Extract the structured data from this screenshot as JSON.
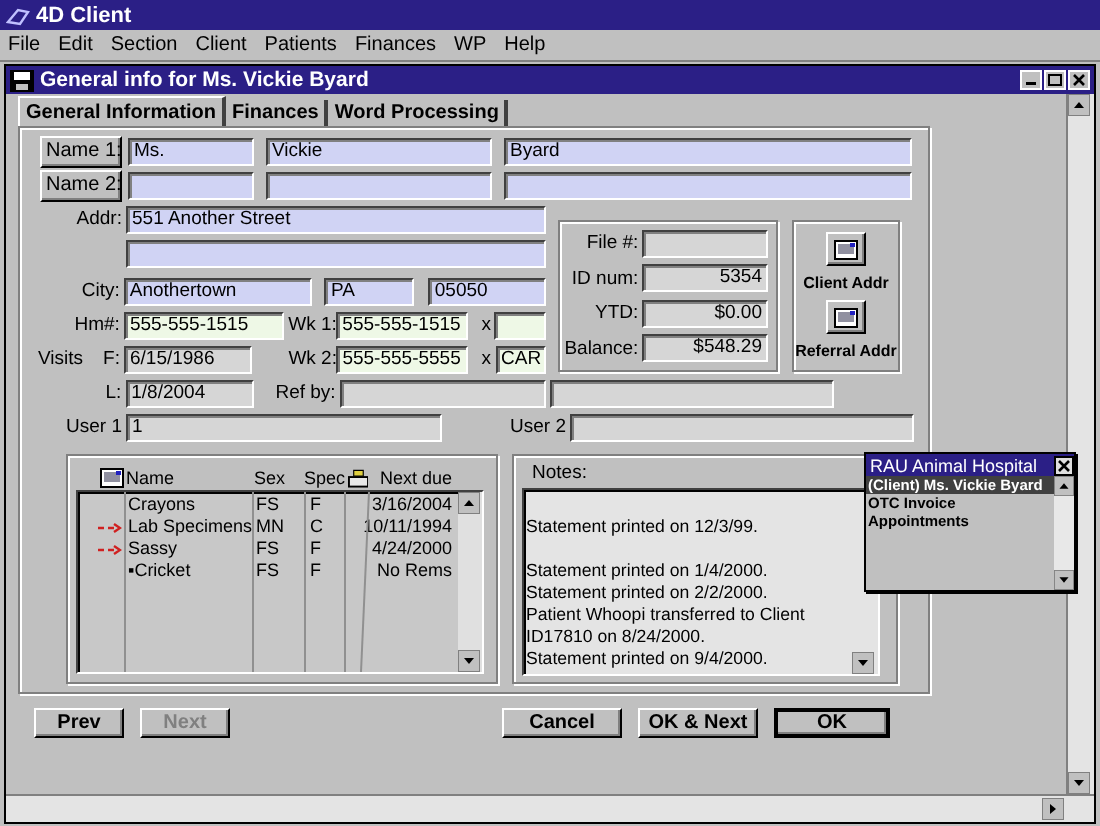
{
  "app_title": "4D Client",
  "menu": [
    "File",
    "Edit",
    "Section",
    "Client",
    "Patients",
    "Finances",
    "WP",
    "Help"
  ],
  "window_title": "General info for Ms. Vickie Byard",
  "tabs": [
    {
      "label": "General Information",
      "selected": true
    },
    {
      "label": "Finances",
      "selected": false
    },
    {
      "label": "Word Processing",
      "selected": false
    }
  ],
  "name_rows": [
    {
      "button": "Name 1:",
      "fields": [
        "Ms.",
        "Vickie",
        "Byard"
      ]
    },
    {
      "button": "Name 2:"
    }
  ],
  "address": {
    "label": "Addr:",
    "line1": "551 Another Street"
  },
  "city": {
    "label": "City:",
    "city": "Anothertown",
    "state": "PA",
    "zip": "05050"
  },
  "home_phone": {
    "label": "Hm#:",
    "value": "555-555-1515"
  },
  "work1": {
    "label": "Wk 1:",
    "value": "555-555-1515",
    "ext_label": "x"
  },
  "work2": {
    "label": "Wk 2:",
    "value": "555-555-5555",
    "ext_label": "x",
    "ext": "CAR"
  },
  "visits": {
    "label": "Visits",
    "first_label": "F:",
    "first": "6/15/1986",
    "last_label": "L:",
    "last": "1/8/2004"
  },
  "ref_by": {
    "label": "Ref by:"
  },
  "user1": {
    "label": "User 1",
    "value": "1"
  },
  "user2": {
    "label": "User 2"
  },
  "account": [
    {
      "label": "File #:"
    },
    {
      "label": "ID num:",
      "value": "5354"
    },
    {
      "label": "YTD:",
      "value": "$0.00"
    },
    {
      "label": "Balance:",
      "value": "$548.29"
    }
  ],
  "address_buttons": [
    {
      "label": "Client Addr"
    },
    {
      "label": "Referral Addr"
    }
  ],
  "patients": {
    "columns": [
      "Name",
      "Sex",
      "Spec",
      "Next due"
    ],
    "rows": [
      {
        "name": "Crayons",
        "sex": "FS",
        "spec": "F",
        "next_due": "3/16/2004",
        "flagged": false
      },
      {
        "name": "Lab Specimens",
        "sex": "MN",
        "spec": "C",
        "next_due": "10/11/1994",
        "flagged": true
      },
      {
        "name": "Sassy",
        "sex": "FS",
        "spec": "F",
        "next_due": "4/24/2000",
        "flagged": true
      },
      {
        "name": "▪Cricket",
        "sex": "FS",
        "spec": "F",
        "next_due": "No Rems",
        "flagged": false
      }
    ]
  },
  "notes": {
    "label": "Notes:",
    "lines": [
      {
        "text": "Statement printed on 12/3/99.",
        "gap_before": true
      },
      {
        "text": "Statement printed on 1/4/2000.",
        "gap_before": true
      },
      {
        "text": "Statement printed on 2/2/2000.",
        "gap_before": false
      },
      {
        "text": "Patient Whoopi transferred to Client ID17810 on 8/24/2000.",
        "gap_before": false
      },
      {
        "text": "Statement printed on 9/4/2000.",
        "gap_before": false
      }
    ]
  },
  "buttons": [
    {
      "label": "Prev",
      "disabled": false,
      "kind": "nav"
    },
    {
      "label": "Next",
      "disabled": true,
      "kind": "nav"
    },
    {
      "label": "Cancel",
      "disabled": false,
      "kind": "action"
    },
    {
      "label": "OK & Next",
      "disabled": false,
      "kind": "action"
    },
    {
      "label": "OK",
      "disabled": false,
      "kind": "default"
    }
  ],
  "palette": {
    "title": "RAU Animal Hospital",
    "items": [
      {
        "label": "(Client) Ms. Vickie Byard",
        "selected": true
      },
      {
        "label": "OTC Invoice",
        "selected": false
      },
      {
        "label": "Appointments",
        "selected": false
      }
    ]
  }
}
